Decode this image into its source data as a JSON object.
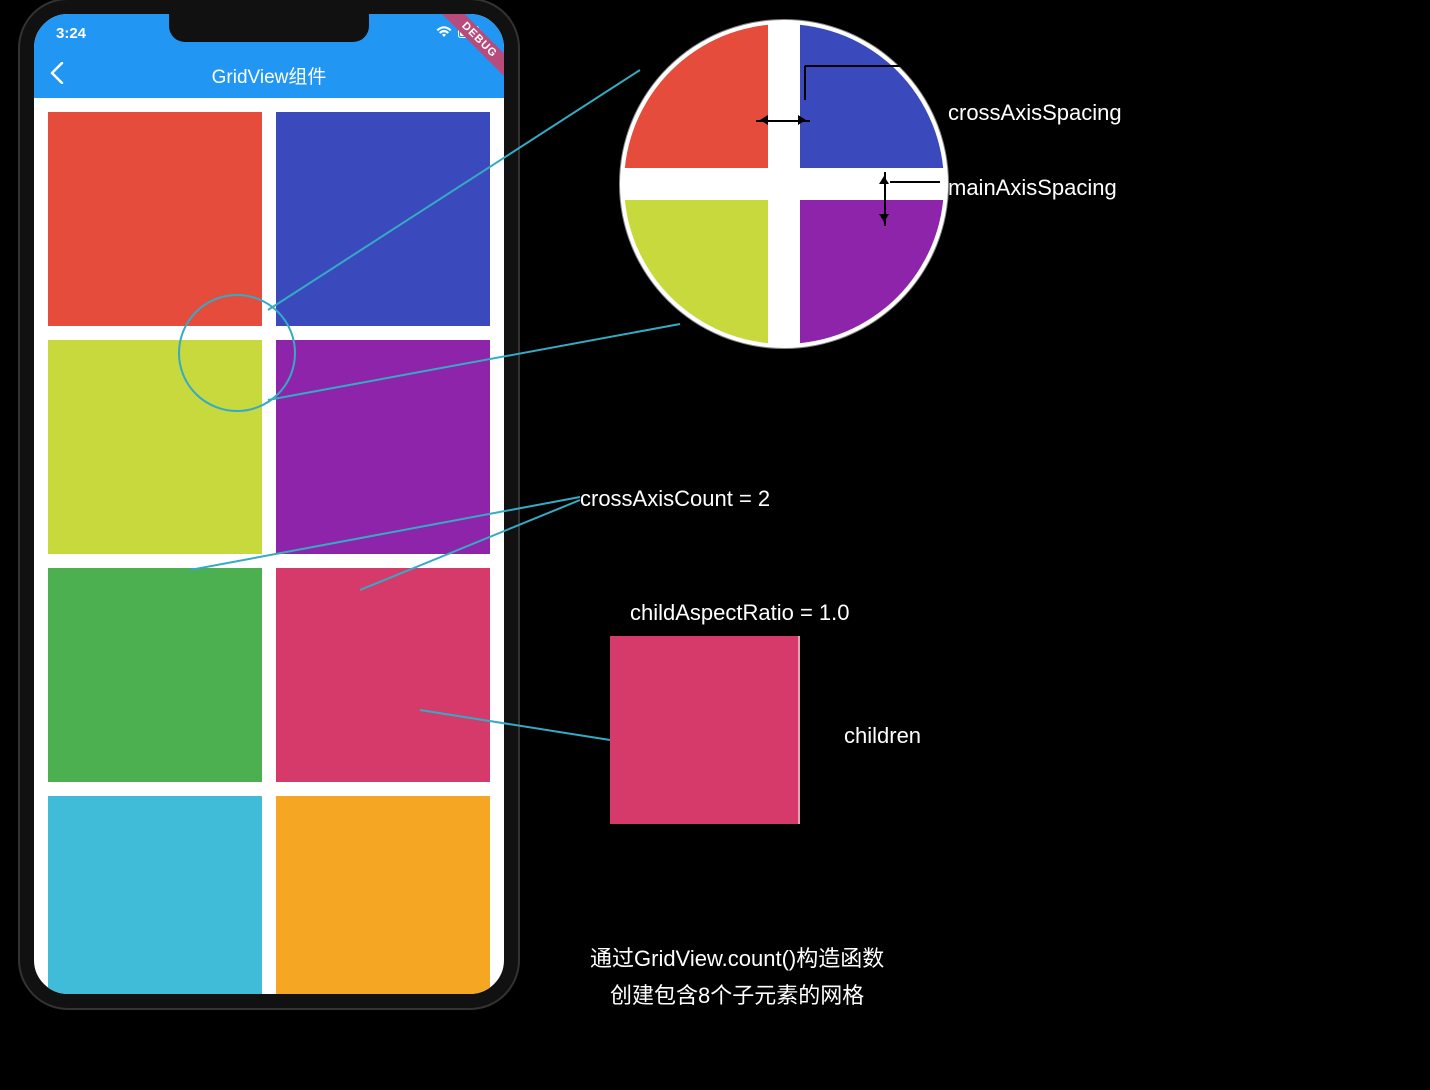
{
  "phone": {
    "status": {
      "time": "3:24",
      "debug_label": "DEBUG"
    },
    "app_bar": {
      "title": "GridView组件"
    },
    "grid_tiles": [
      {
        "color": "#E64C3C"
      },
      {
        "color": "#3A49BC"
      },
      {
        "color": "#C7D93D"
      },
      {
        "color": "#8E24AA"
      },
      {
        "color": "#4CAF50"
      },
      {
        "color": "#D63A6A"
      },
      {
        "color": "#40BCD8"
      },
      {
        "color": "#F5A623"
      }
    ]
  },
  "annotations": {
    "crossAxisSpacing": "crossAxisSpacing",
    "mainAxisSpacing": "mainAxisSpacing",
    "crossAxisCount": "crossAxisCount = 2",
    "childAspectRatio": "childAspectRatio = 1.0",
    "children_label": "children",
    "note": "通过GridView.count()构造函数\n创建包含8个子元素的网格"
  }
}
